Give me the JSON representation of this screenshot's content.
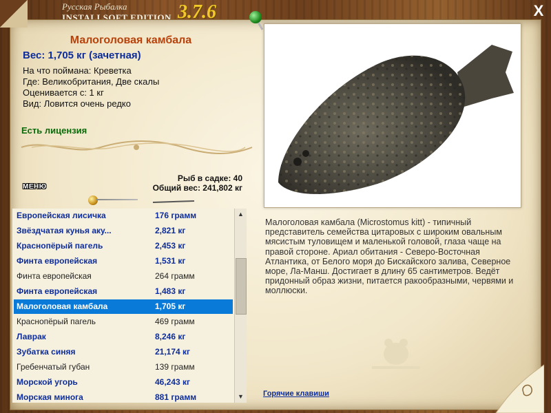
{
  "app": {
    "title_line1": "Русская Рыбалка",
    "title_line2": "INSTALLSOFT EDITION",
    "version": "3.7.6"
  },
  "fish": {
    "name": "Малоголовая камбала",
    "weight": "Вес: 1,705 кг (зачетная)",
    "bait": "На что поймана: Креветка",
    "place": "Где: Великобритания, Две скалы",
    "rated": "Оценивается с: 1 кг",
    "rarity": "Вид: Ловится очень редко",
    "license": "Есть лицензия",
    "description": "Малоголовая камбала (Microstomus kitt) - типичный представитель семейства цитаровых с широким овальным мясистым туловищем и маленькой головой, глаза чаще на правой стороне. Ариал обитания - Северо-Восточная Атлантика, от Белого моря до Бискайского залива, Северное море, Ла-Манш. Достигает в длину 65 сантиметров. Ведёт придонный образ жизни, питается ракообразными, червями и моллюски."
  },
  "stats": {
    "fish_count": "Рыб в садке: 40",
    "total_weight": "Общий вес: 241,802 кг"
  },
  "menu_label": "МЕНЮ",
  "hotkeys_label": "Горячие клавиши",
  "close_label": "X",
  "list": [
    {
      "name": "Европейская лисичка",
      "weight": "176 грамм",
      "style": "bold"
    },
    {
      "name": "Звёздчатая кунья аку...",
      "weight": "2,821 кг",
      "style": "bold"
    },
    {
      "name": "Краснопёрый пагель",
      "weight": "2,453 кг",
      "style": "bold"
    },
    {
      "name": "Финта европейская",
      "weight": "1,531 кг",
      "style": "bold"
    },
    {
      "name": "Финта европейская",
      "weight": "264 грамм",
      "style": "norm"
    },
    {
      "name": "Финта европейская",
      "weight": "1,483 кг",
      "style": "bold"
    },
    {
      "name": "Малоголовая камбала",
      "weight": "1,705 кг",
      "style": "sel"
    },
    {
      "name": "Краснопёрый пагель",
      "weight": "469 грамм",
      "style": "norm"
    },
    {
      "name": "Лаврак",
      "weight": "8,246 кг",
      "style": "bold"
    },
    {
      "name": "Зубатка синяя",
      "weight": "21,174 кг",
      "style": "bold"
    },
    {
      "name": "Гребенчатый губан",
      "weight": "139 грамм",
      "style": "norm"
    },
    {
      "name": "Морской угорь",
      "weight": "46,243 кг",
      "style": "bold"
    },
    {
      "name": "Морская минога",
      "weight": "881 грамм",
      "style": "bold"
    }
  ]
}
